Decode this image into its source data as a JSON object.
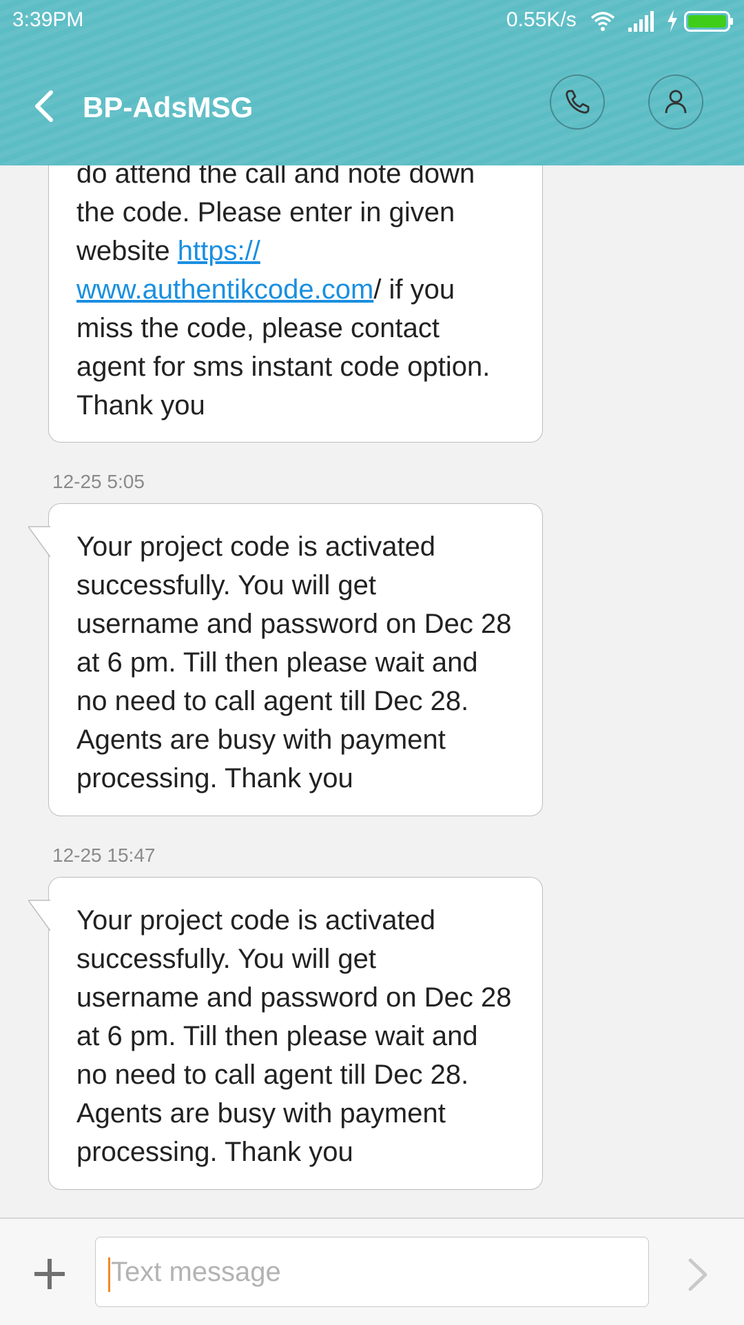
{
  "status_bar": {
    "time": "3:39PM",
    "network_speed": "0.55K/s",
    "icons": [
      "wifi-icon",
      "signal-icon",
      "charging-icon",
      "battery-icon"
    ]
  },
  "header": {
    "title": "BP-AdsMSG",
    "background_color": "#5dbdc5",
    "icons": [
      "back-arrow-icon",
      "phone-icon",
      "contact-icon"
    ]
  },
  "messages": [
    {
      "timestamp": "",
      "lines": [
        "do attend the call and note down",
        "the code. Please enter in given",
        {
          "text_before": "website ",
          "link": "https://"
        },
        {
          "link": "www.authentikcode.com",
          "text_after": "/ if you"
        },
        "miss the code, please contact",
        "agent for sms instant code option.",
        "Thank you"
      ]
    },
    {
      "timestamp": "12-25 5:05",
      "lines": [
        "Your project code is activated",
        "successfully. You will get",
        "username and password on Dec 28",
        "at 6 pm. Till then please wait and",
        "no need to call agent till Dec 28.",
        "Agents are busy with payment",
        "processing. Thank you"
      ]
    },
    {
      "timestamp": "12-25 15:47",
      "lines": [
        "Your project code is activated",
        "successfully. You will get",
        "username and password on Dec 28",
        "at 6 pm. Till then please wait and",
        "no need to call agent till Dec 28.",
        "Agents are busy with payment",
        "processing. Thank you"
      ]
    }
  ],
  "composer": {
    "placeholder": "Text message",
    "value": "",
    "icons": [
      "plus-icon",
      "send-icon"
    ],
    "cursor_color": "#f08a24"
  }
}
